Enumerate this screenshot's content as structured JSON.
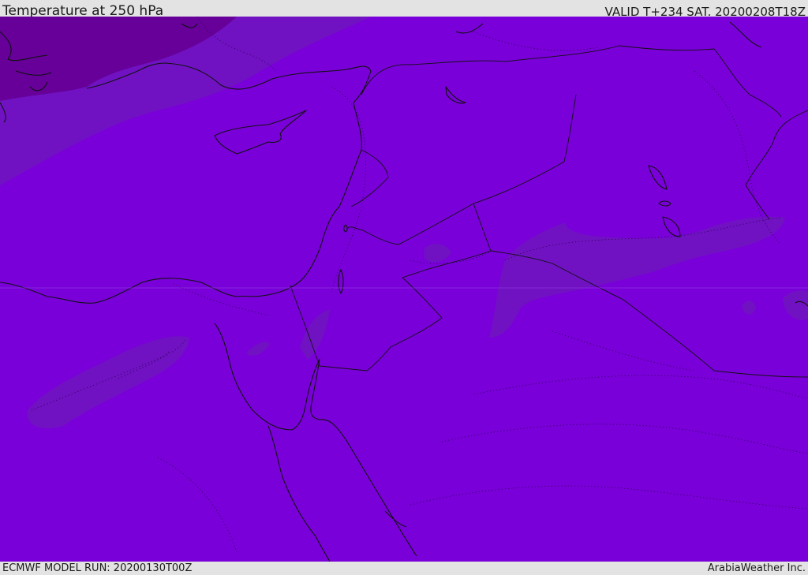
{
  "header": {
    "title": "Temperature at 250 hPa",
    "valid": "VALID T+234 SAT. 20200208T18Z"
  },
  "footer": {
    "model_run": "ECMWF MODEL RUN: 20200130T00Z",
    "credit": "ArabiaWeather Inc."
  },
  "colors": {
    "base_field": "#7a00d9",
    "cooler_band": "#7012c2",
    "coldest_band": "#660099",
    "coastline": "#111111",
    "label_bar_bg": "#e3e3e3"
  },
  "layers": [
    "temperature-fill",
    "coastlines",
    "country-borders",
    "isotherm-contours"
  ]
}
